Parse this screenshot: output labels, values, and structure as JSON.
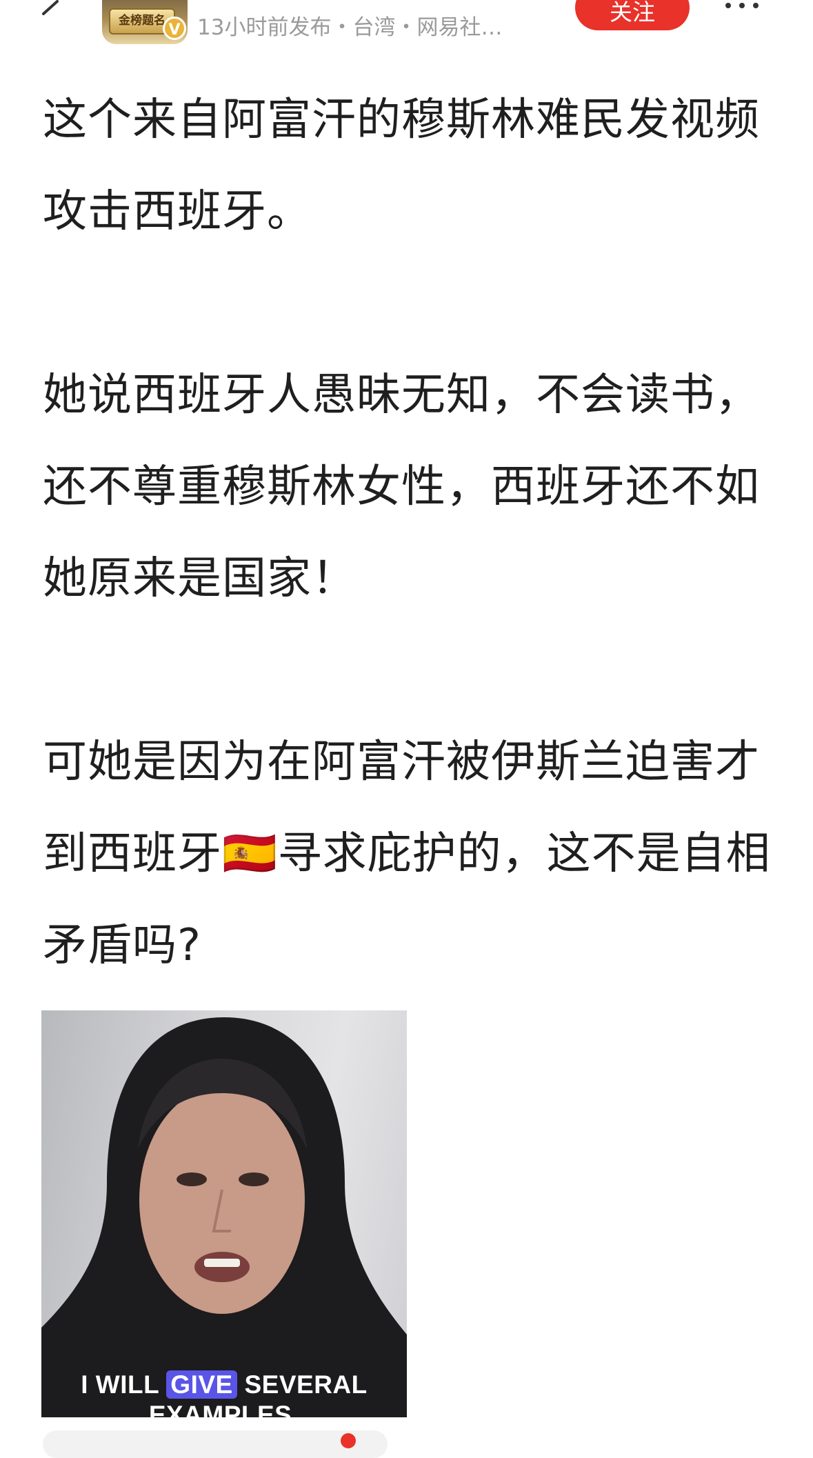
{
  "header": {
    "avatar_text": "金榜题名",
    "verified_mark": "V",
    "author_name": "",
    "meta": "13小时前发布・台湾・网易社…",
    "follow_label": "关注"
  },
  "post": {
    "paragraphs": [
      "这个来自阿富汗的穆斯林难民发视频攻击西班牙。",
      "她说西班牙人愚昧无知，不会读书，还不尊重穆斯林女性，西班牙还不如她原来是国家！",
      "可她是因为在阿富汗被伊斯兰迫害才到西班牙🇪🇸寻求庇护的，这不是自相矛盾吗?"
    ]
  },
  "video": {
    "caption_line1_pre": "I WILL ",
    "caption_line1_highlight": "GIVE",
    "caption_line1_post": " SEVERAL",
    "caption_line2": "EXAMPLES."
  },
  "colors": {
    "accent": "#e8322a",
    "caption_highlight": "#5a55e6",
    "meta_text": "#9a9a9a"
  }
}
